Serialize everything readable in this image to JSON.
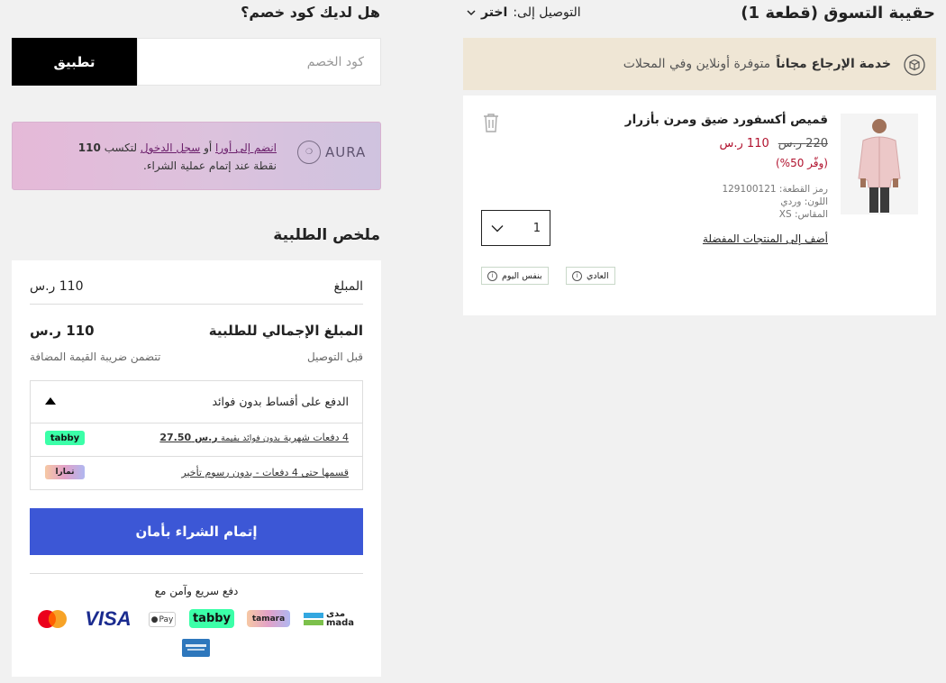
{
  "bag": {
    "title": "حقيبة التسوق (قطعة 1)",
    "delivery_label": "التوصيل إلى:",
    "delivery_value": "اختر"
  },
  "returns_banner": {
    "bold": "خدمة الإرجاع مجاناً",
    "text": "متوفرة أونلاين وفي المحلات",
    "icon": "box-return-icon"
  },
  "item": {
    "name": "قميص أكسفورد ضيق ومرن بأزرار",
    "old_price": "220 ر.س",
    "new_price": "110 ر.س",
    "save": "(وفّر 50%)",
    "sku": "رمز القطعة: 129100121",
    "color": "اللون: وردي",
    "size": "المقاس: XS",
    "wishlist": "أضف إلى المنتجات المفضلة",
    "quantity": "1",
    "shipping_options": [
      "العادي",
      "بنفس اليوم"
    ],
    "image_icon": "product-photo"
  },
  "promo": {
    "title": "هل لديك كود خصم؟",
    "placeholder": "كود الخصم",
    "apply": "تطبيق"
  },
  "aura": {
    "logo": "AURA",
    "join": "انضم إلى أورا",
    "or": "أو",
    "login": "سجل الدخول",
    "rest": "لتكسب",
    "points": "110",
    "line2": "نقطة عند إتمام عملية الشراء."
  },
  "summary": {
    "title": "ملخص الطلبية",
    "amount_label": "المبلغ",
    "amount_value": "110 ر.س",
    "total_label": "المبلغ الإجمالي للطلبية",
    "total_value": "110 ر.س",
    "before_delivery": "قبل التوصيل",
    "vat_included": "تتضمن ضريبة القيمة المضافة"
  },
  "installments": {
    "title": "الدفع على أقساط بدون فوائد",
    "tabby_text": "4 دفعات شهرية",
    "tabby_suffix": "بدون فوائد بقيمة",
    "tabby_amount": "ر.س 27.50",
    "tabby_logo": "tabby",
    "tamara_text": "قسمها حتى 4 دفعات - بدون رسوم تأخير",
    "tamara_logo": "تمارا"
  },
  "checkout": {
    "button": "إتمام الشراء بأمان",
    "pay_title": "دفع سريع وآمن مع",
    "logos": [
      "mada",
      "tamara",
      "tabby",
      "Apple Pay",
      "VISA",
      "mastercard",
      "American Express"
    ],
    "mada_ar": "مدى",
    "mada_en": "mada",
    "tamara_en": "tamara",
    "tabby": "tabby",
    "applepay": "Pay",
    "visa": "VISA"
  },
  "colors": {
    "brand_blue": "#3c57d6",
    "sale_red": "#b1132f",
    "banner_beige": "#efe6d5",
    "tabby_green": "#3bffa8"
  }
}
